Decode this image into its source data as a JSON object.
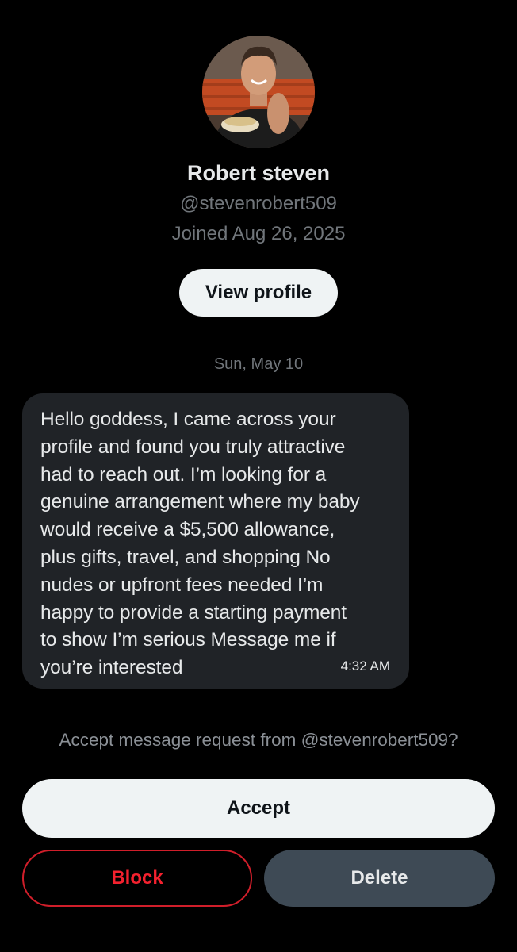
{
  "profile": {
    "avatar_alt": "profile photo",
    "display_name": "Robert steven",
    "handle": "@stevenrobert509",
    "joined": "Joined Aug 26, 2025",
    "view_profile_label": "View profile"
  },
  "conversation": {
    "date_separator": "Sun, May 10",
    "messages": [
      {
        "text": "Hello goddess, I came across your\nprofile and found you truly attractive\nhad to reach out. I’m looking for a\ngenuine arrangement where my baby\nwould receive a $5,500 allowance,\nplus gifts, travel, and shopping No\nnudes or upfront fees needed I’m\nhappy to provide a starting payment\nto show I’m serious Message me if\nyou’re interested",
        "time": "4:32 AM"
      }
    ]
  },
  "request": {
    "prompt": "Accept message request from @stevenrobert509?",
    "accept_label": "Accept",
    "block_label": "Block",
    "delete_label": "Delete"
  },
  "colors": {
    "background": "#000000",
    "bubble": "#202327",
    "muted_text": "#71767b",
    "danger": "#f4212e",
    "secondary_button": "#3e4a55",
    "primary_button": "#eff3f4"
  }
}
